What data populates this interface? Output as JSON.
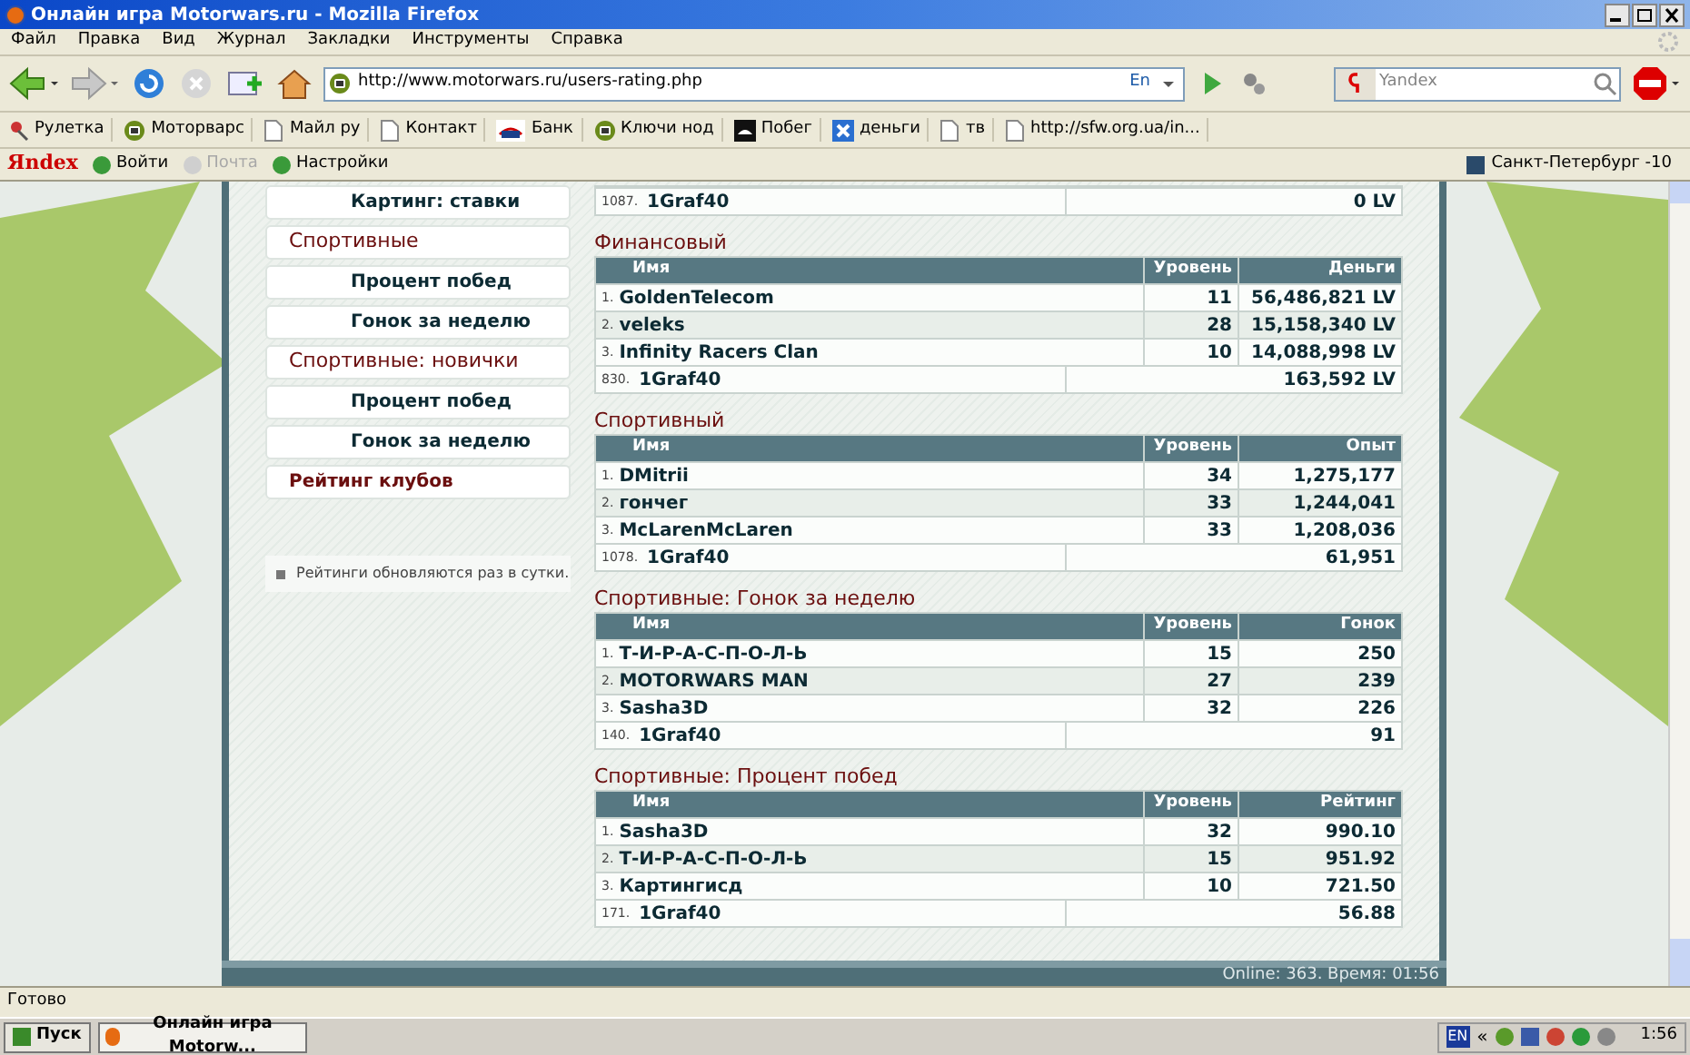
{
  "window": {
    "title": "Онлайн игра Motorwars.ru - Mozilla Firefox"
  },
  "menu": [
    "Файл",
    "Правка",
    "Вид",
    "Журнал",
    "Закладки",
    "Инструменты",
    "Справка"
  ],
  "nav": {
    "url": "http://www.motorwars.ru/users-rating.php",
    "lang": "En",
    "search_placeholder": "Yandex"
  },
  "bookmarks": [
    {
      "label": "Рулетка",
      "kind": "pin"
    },
    {
      "label": "Моторварс",
      "kind": "site"
    },
    {
      "label": "Майл ру",
      "kind": "page"
    },
    {
      "label": "Контакт",
      "kind": "page"
    },
    {
      "label": "Банк",
      "kind": "bank"
    },
    {
      "label": "Ключи нод",
      "kind": "site"
    },
    {
      "label": "Побег",
      "kind": "dark"
    },
    {
      "label": "деньги",
      "kind": "cross"
    },
    {
      "label": "тв",
      "kind": "page"
    },
    {
      "label": "http://sfw.org.ua/in...",
      "kind": "page"
    }
  ],
  "yandex_bar": {
    "logo": "Яndex",
    "items": [
      {
        "label": "Войти",
        "disabled": false
      },
      {
        "label": "Почта",
        "disabled": true
      },
      {
        "label": "Настройки",
        "disabled": false
      }
    ],
    "weather": "Санкт-Петербург -10"
  },
  "sidebar": {
    "items": [
      {
        "label": "Картинг: ставки",
        "kind": "sub"
      },
      {
        "label": "Спортивные",
        "kind": "section"
      },
      {
        "label": "Процент побед",
        "kind": "sub"
      },
      {
        "label": "Гонок за неделю",
        "kind": "sub"
      },
      {
        "label": "Спортивные: новички",
        "kind": "section"
      },
      {
        "label": "Процент побед",
        "kind": "sub"
      },
      {
        "label": "Гонок за неделю",
        "kind": "sub"
      },
      {
        "label": "Рейтинг клубов",
        "kind": "link"
      }
    ],
    "note": "Рейтинги обновляются раз в сутки."
  },
  "top_fragment": {
    "rank": "1087.",
    "name": "1Graf40",
    "value": "0 LV"
  },
  "sections": [
    {
      "title": "Финансовый",
      "columns": [
        "Имя",
        "Уровень",
        "Деньги"
      ],
      "rows": [
        {
          "rank": "1.",
          "name": "GoldenTelecom",
          "level": "11",
          "value": "56,486,821 LV"
        },
        {
          "rank": "2.",
          "name": "veleks",
          "level": "28",
          "value": "15,158,340 LV"
        },
        {
          "rank": "3.",
          "name": "Infinity Racers Clan",
          "level": "10",
          "value": "14,088,998 LV"
        }
      ],
      "own": {
        "rank": "830.",
        "name": "1Graf40",
        "value": "163,592 LV"
      }
    },
    {
      "title": "Спортивный",
      "columns": [
        "Имя",
        "Уровень",
        "Опыт"
      ],
      "rows": [
        {
          "rank": "1.",
          "name": "DMitrii",
          "level": "34",
          "value": "1,275,177"
        },
        {
          "rank": "2.",
          "name": "гончег",
          "level": "33",
          "value": "1,244,041"
        },
        {
          "rank": "3.",
          "name": "McLarenMcLaren",
          "level": "33",
          "value": "1,208,036"
        }
      ],
      "own": {
        "rank": "1078.",
        "name": "1Graf40",
        "value": "61,951"
      }
    },
    {
      "title": "Спортивные: Гонок за неделю",
      "columns": [
        "Имя",
        "Уровень",
        "Гонок"
      ],
      "rows": [
        {
          "rank": "1.",
          "name": "Т-И-Р-А-С-П-О-Л-Ь",
          "level": "15",
          "value": "250"
        },
        {
          "rank": "2.",
          "name": "MOTORWARS MAN",
          "level": "27",
          "value": "239"
        },
        {
          "rank": "3.",
          "name": "Sasha3D",
          "level": "32",
          "value": "226"
        }
      ],
      "own": {
        "rank": "140.",
        "name": "1Graf40",
        "value": "91"
      }
    },
    {
      "title": "Спортивные: Процент побед",
      "columns": [
        "Имя",
        "Уровень",
        "Рейтинг"
      ],
      "rows": [
        {
          "rank": "1.",
          "name": "Sasha3D",
          "level": "32",
          "value": "990.10"
        },
        {
          "rank": "2.",
          "name": "Т-И-Р-А-С-П-О-Л-Ь",
          "level": "15",
          "value": "951.92"
        },
        {
          "rank": "3.",
          "name": "Картингисд",
          "level": "10",
          "value": "721.50"
        }
      ],
      "own": {
        "rank": "171.",
        "name": "1Graf40",
        "value": "56.88"
      }
    }
  ],
  "online": "Online: 363. Время: 01:56",
  "status_bar": "Готово",
  "taskbar": {
    "start": "Пуск",
    "task": "Онлайн игра Motorw...",
    "lang": "EN",
    "expand": "«",
    "clock": "1:56"
  }
}
